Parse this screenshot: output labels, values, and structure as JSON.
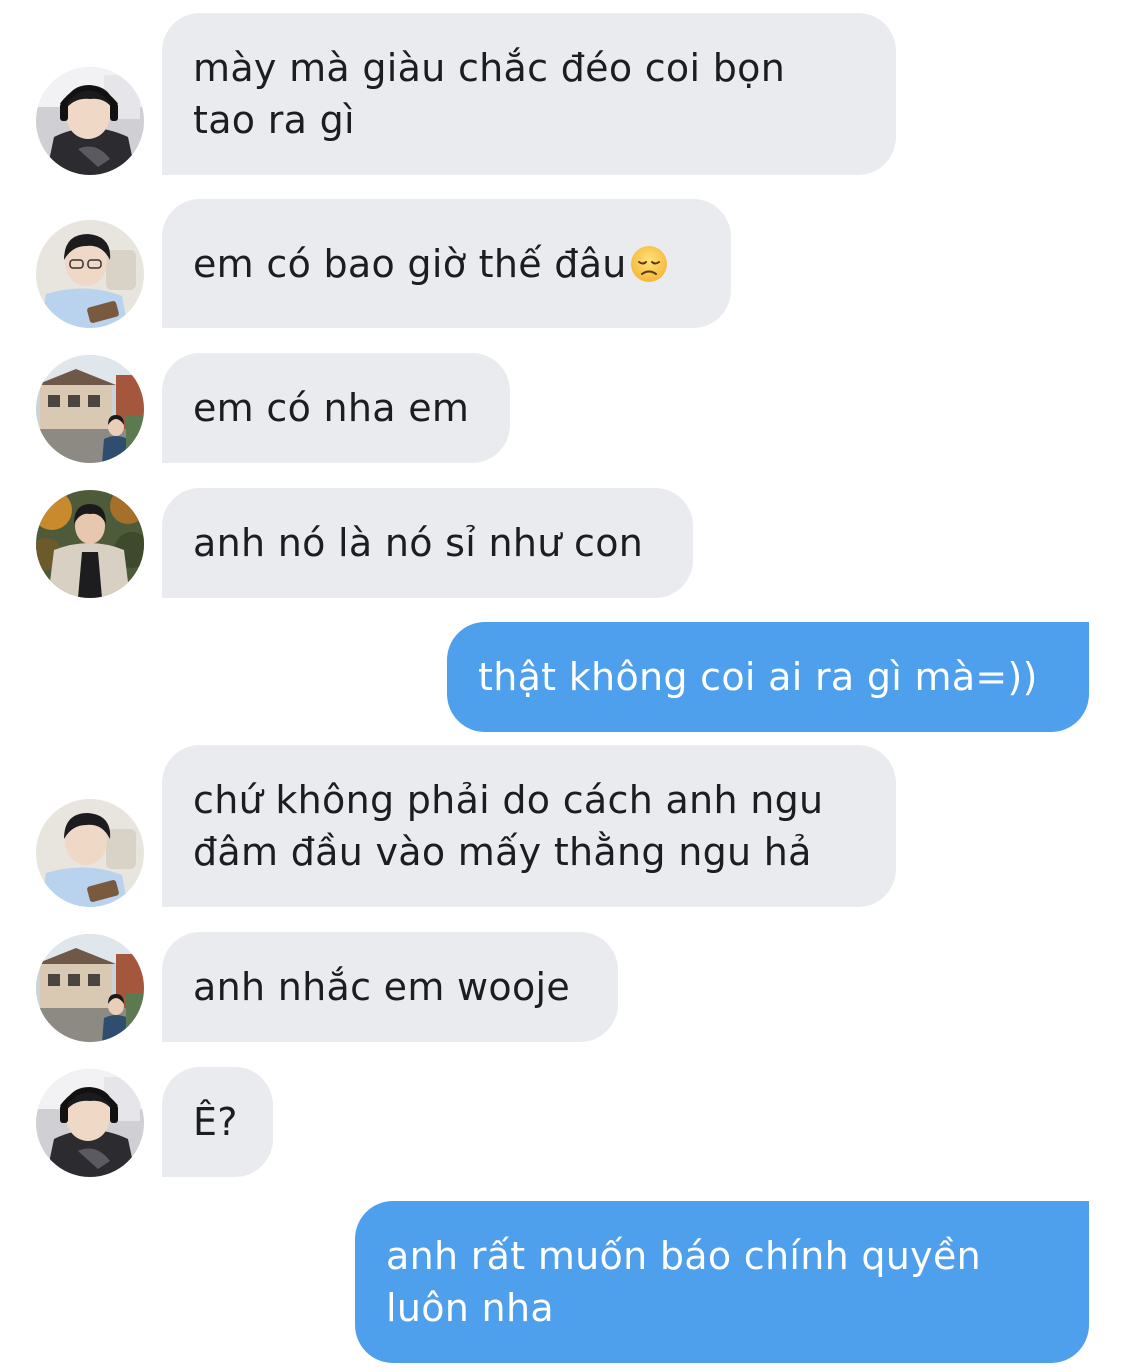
{
  "messages": [
    {
      "sender": "incoming",
      "avatar": "headset-user",
      "text": "mày mà giàu chắc đéo coi bọn\ntao ra gì"
    },
    {
      "sender": "incoming",
      "avatar": "blue-shirt-user",
      "text": "em có bao giờ thế đâu",
      "emoji": "disappointed-face"
    },
    {
      "sender": "incoming",
      "avatar": "street-user",
      "text": "em có nha em"
    },
    {
      "sender": "incoming",
      "avatar": "cardigan-user",
      "text": "anh nó là nó sỉ như con"
    },
    {
      "sender": "outgoing",
      "text": "thật không coi ai ra gì mà=))"
    },
    {
      "sender": "incoming",
      "avatar": "blue-shirt-user",
      "text": "chứ không phải do cách anh ngu\nđâm đầu vào mấy thằng ngu hả"
    },
    {
      "sender": "incoming",
      "avatar": "street-user",
      "text": "anh nhắc em wooje"
    },
    {
      "sender": "incoming",
      "avatar": "headset-user",
      "text": "Ê?"
    },
    {
      "sender": "outgoing",
      "text": "anh rất muốn báo chính quyền\nluôn nha"
    }
  ],
  "colors": {
    "incoming_bubble": "#e9ebef",
    "outgoing_bubble": "#4e9fec",
    "incoming_text": "#1d1d1f",
    "outgoing_text": "#ffffff"
  }
}
